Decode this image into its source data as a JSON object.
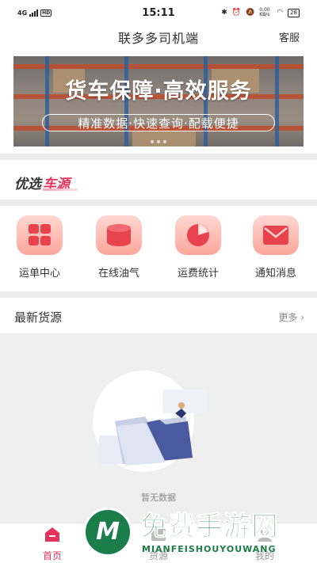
{
  "status_bar": {
    "network": "4G",
    "hd": "HD",
    "time": "15:11",
    "net_speed": "0.00 KB/s",
    "battery": "28"
  },
  "header": {
    "title": "联多多司机端",
    "service_label": "客服"
  },
  "banner": {
    "headline": "货车保障·高效服务",
    "subline": "精准数据·快速查询·配载便捷",
    "dot_count": 3
  },
  "section": {
    "title_black": "优选",
    "title_red": "车源"
  },
  "menu": {
    "items": [
      {
        "label": "运单中心",
        "icon": "grid-icon"
      },
      {
        "label": "在线油气",
        "icon": "cylinder-icon"
      },
      {
        "label": "运费统计",
        "icon": "pie-chart-icon"
      },
      {
        "label": "通知消息",
        "icon": "envelope-icon"
      }
    ]
  },
  "latest": {
    "title": "最新货源",
    "more_label": "更多"
  },
  "empty_state": {
    "message": "暂无数据"
  },
  "tabbar": {
    "tabs": [
      {
        "label": "首页",
        "active": true
      },
      {
        "label": "货源",
        "active": false
      },
      {
        "label": "我的",
        "active": false
      }
    ]
  },
  "watermark": {
    "logo_letter": "M",
    "title": "免费手游网",
    "subtitle": "MIANFEISHOUYOUWANG"
  },
  "colors": {
    "accent": "#e6335e",
    "tile_top": "#ffd7d2",
    "tile_bottom": "#fca69b",
    "watermark_green": "#1a7c47"
  }
}
